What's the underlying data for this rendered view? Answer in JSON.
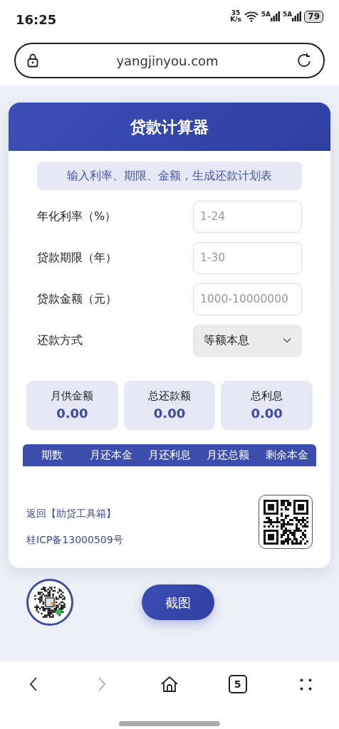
{
  "status_bar": {
    "time": "16:25",
    "speed": "35",
    "speed_unit": "K/s",
    "sim_labels": [
      "5A",
      "5A"
    ],
    "battery": "79"
  },
  "address_bar": {
    "url": "yangjinyou.com"
  },
  "calculator": {
    "title": "贷款计算器",
    "subtitle": "输入利率、期限、金额，生成还款计划表",
    "fields": [
      {
        "kind": "input",
        "label": "年化利率（%）",
        "placeholder": "1-24"
      },
      {
        "kind": "input",
        "label": "贷款期限（年）",
        "placeholder": "1-30"
      },
      {
        "kind": "input",
        "label": "贷款金额（元）",
        "placeholder": "1000-10000000"
      },
      {
        "kind": "select",
        "label": "还款方式",
        "value": "等额本息"
      }
    ],
    "summary": [
      {
        "label": "月供金额",
        "value": "0.00"
      },
      {
        "label": "总还款额",
        "value": "0.00"
      },
      {
        "label": "总利息",
        "value": "0.00"
      }
    ],
    "table": {
      "columns": [
        "期数",
        "月还本金",
        "月还利息",
        "月还总额",
        "剩余本金"
      ]
    },
    "footer_links": [
      "返回【助贷工具箱】",
      "桂ICP备13000509号"
    ]
  },
  "screenshot_button": "截图",
  "nav_bar": [
    {
      "kind": "back",
      "disabled": false
    },
    {
      "kind": "forward",
      "disabled": true
    },
    {
      "kind": "home",
      "disabled": false
    },
    {
      "kind": "tabs",
      "label": "5",
      "disabled": false
    },
    {
      "kind": "menu",
      "disabled": false
    }
  ]
}
